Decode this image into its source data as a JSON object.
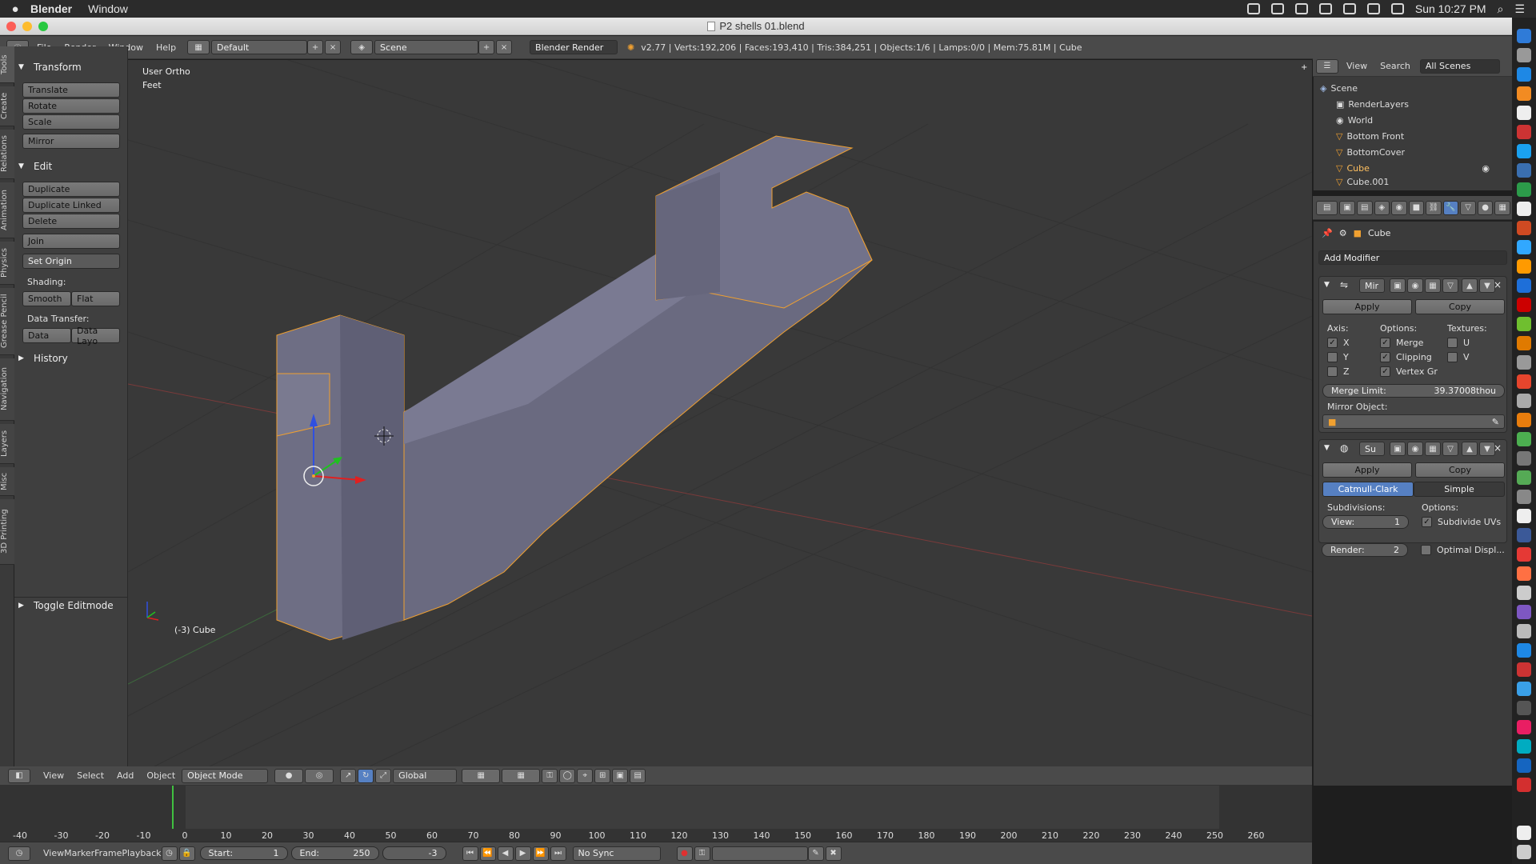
{
  "menubar": {
    "app": "Blender",
    "menu": "Window",
    "clock": "Sun 10:27 PM"
  },
  "window": {
    "title": "P2 shells 01.blend"
  },
  "info": {
    "menus": [
      "File",
      "Render",
      "Window",
      "Help"
    ],
    "layout": "Default",
    "scene": "Scene",
    "engine": "Blender Render",
    "stats": "v2.77 | Verts:192,206 | Faces:193,410 | Tris:384,251 | Objects:1/6 | Lamps:0/0 | Mem:75.81M | Cube"
  },
  "tool_tabs": [
    "Tools",
    "Create",
    "Relations",
    "Animation",
    "Physics",
    "Grease Pencil",
    "Navigation",
    "Layers",
    "Misc",
    "3D Printing"
  ],
  "toolshelf": {
    "transform": "Transform",
    "translate": "Translate",
    "rotate": "Rotate",
    "scale": "Scale",
    "mirror": "Mirror",
    "edit": "Edit",
    "duplicate": "Duplicate",
    "duplicate_linked": "Duplicate Linked",
    "delete": "Delete",
    "join": "Join",
    "set_origin": "Set Origin",
    "shading": "Shading:",
    "smooth": "Smooth",
    "flat": "Flat",
    "data_transfer": "Data Transfer:",
    "data": "Data",
    "data_layo": "Data Layo",
    "history": "History",
    "toggle_editmode": "Toggle Editmode"
  },
  "viewport": {
    "view_name": "User Ortho",
    "units": "Feet",
    "object_label": "(-3) Cube"
  },
  "viewport_header": {
    "menus": [
      "View",
      "Select",
      "Add",
      "Object"
    ],
    "mode": "Object Mode",
    "orientation": "Global"
  },
  "outliner": {
    "menus": [
      "View",
      "Search"
    ],
    "filter": "All Scenes",
    "items": [
      "Scene",
      "RenderLayers",
      "World",
      "Bottom Front",
      "BottomCover",
      "Cube",
      "Cube.001"
    ]
  },
  "properties": {
    "object": "Cube",
    "add_modifier": "Add Modifier",
    "mirror": {
      "name": "Mir",
      "apply": "Apply",
      "copy": "Copy",
      "axis": "Axis:",
      "options": "Options:",
      "textures": "Textures:",
      "x": "X",
      "y": "Y",
      "z": "Z",
      "merge": "Merge",
      "clipping": "Clipping",
      "vertex_gr": "Vertex Gr",
      "u": "U",
      "v": "V",
      "merge_limit_label": "Merge Limit:",
      "merge_limit_value": "39.37008thou",
      "mirror_object": "Mirror Object:"
    },
    "subsurf": {
      "name": "Su",
      "apply": "Apply",
      "copy": "Copy",
      "catmull": "Catmull-Clark",
      "simple": "Simple",
      "subdivisions": "Subdivisions:",
      "options": "Options:",
      "view_label": "View:",
      "view_value": "1",
      "render_label": "Render:",
      "render_value": "2",
      "subdivide_uvs": "Subdivide UVs",
      "optimal_displ": "Optimal Displ..."
    }
  },
  "timeline": {
    "ticks": [
      "-40",
      "-30",
      "-20",
      "-10",
      "0",
      "10",
      "20",
      "30",
      "40",
      "50",
      "60",
      "70",
      "80",
      "90",
      "100",
      "110",
      "120",
      "130",
      "140",
      "150",
      "160",
      "170",
      "180",
      "190",
      "200",
      "210",
      "220",
      "230",
      "240",
      "250",
      "260"
    ],
    "menus": [
      "View",
      "Marker",
      "Frame",
      "Playback"
    ],
    "start_label": "Start:",
    "start_value": "1",
    "end_label": "End:",
    "end_value": "250",
    "current": "-3",
    "sync": "No Sync"
  },
  "colors": {
    "accent": "#5680c2",
    "selection": "#f0a030",
    "object": "#6c6c82"
  }
}
